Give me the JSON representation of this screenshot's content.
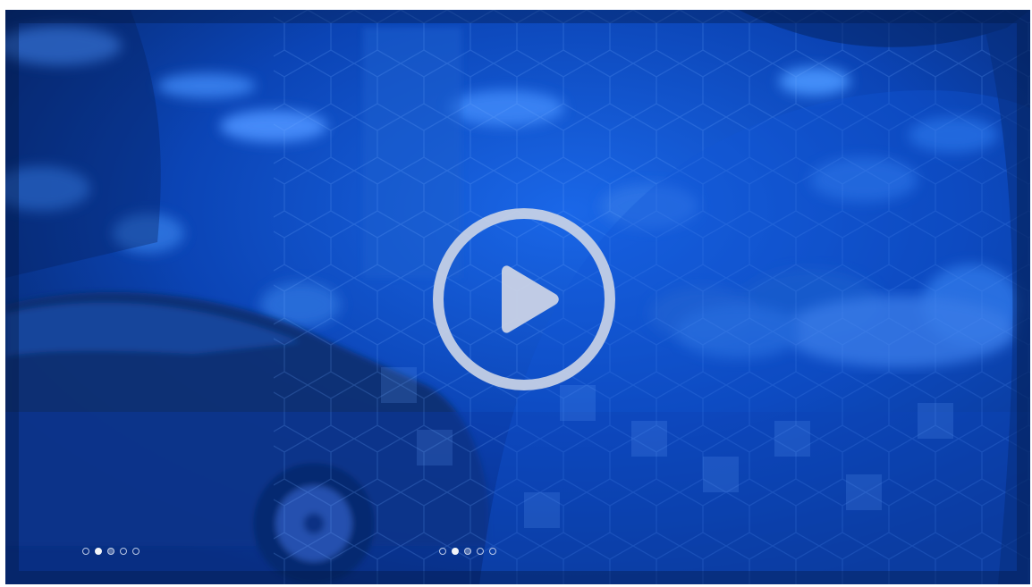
{
  "video": {
    "overlay_color": "#0b49c9",
    "play_icon": "play-circle-icon",
    "play_color": "#c9d2e6"
  },
  "carousel_left": {
    "active_index": 1,
    "count": 5
  },
  "carousel_right": {
    "active_index": 1,
    "count": 5
  }
}
